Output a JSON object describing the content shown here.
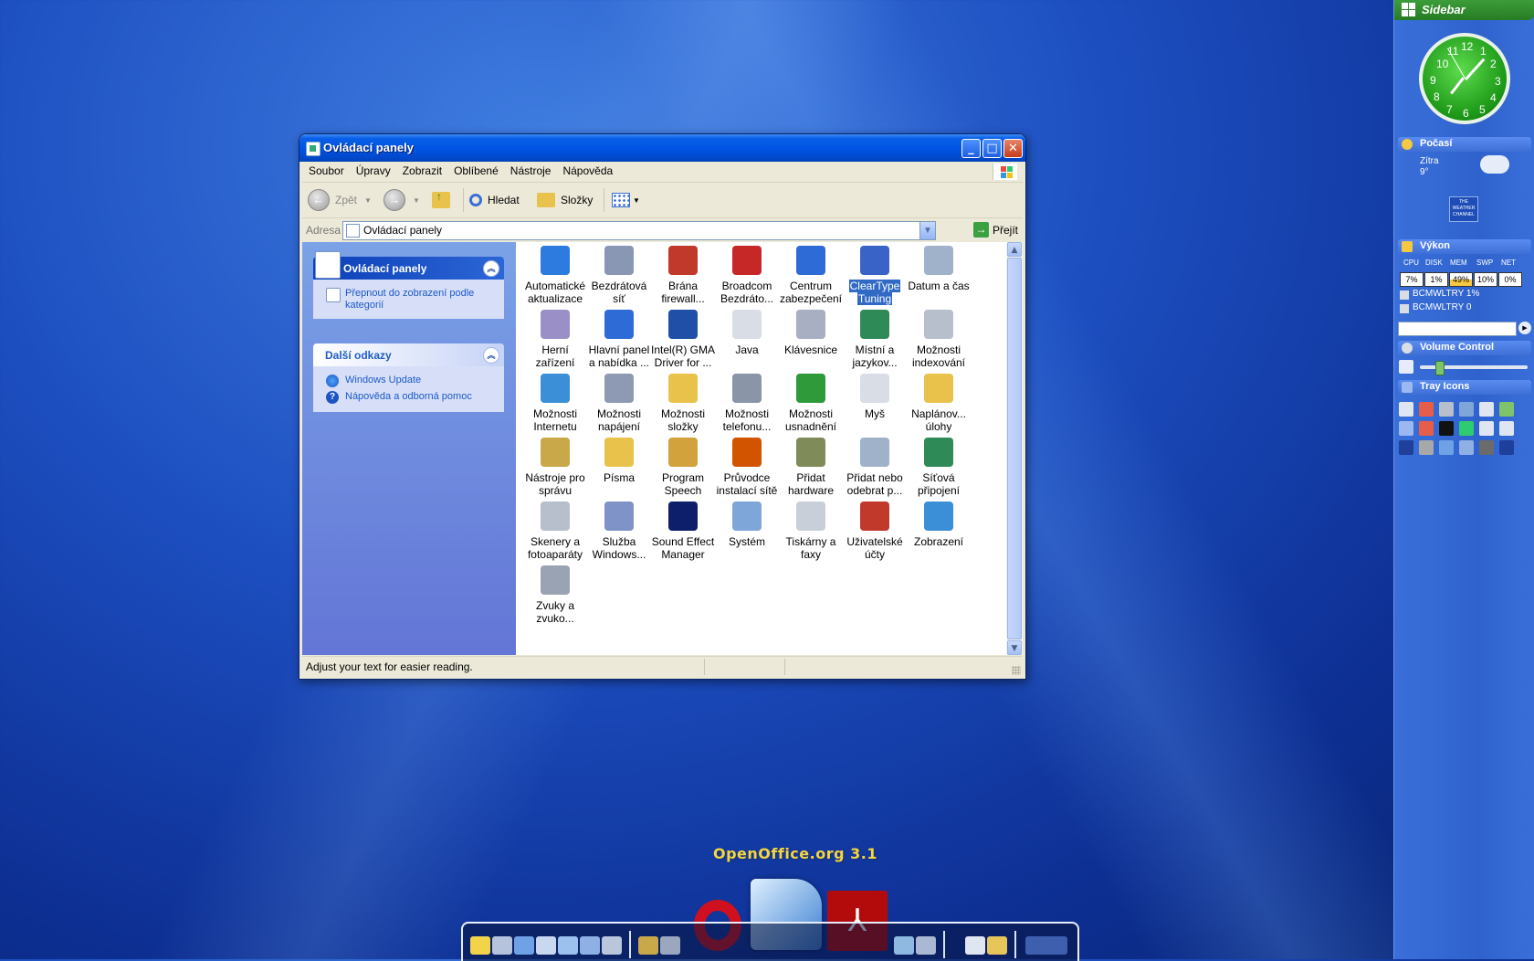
{
  "window": {
    "title": "Ovládací panely",
    "menu": [
      "Soubor",
      "Úpravy",
      "Zobrazit",
      "Oblíbené",
      "Nástroje",
      "Nápověda"
    ],
    "toolbar": {
      "back": "Zpět",
      "search": "Hledat",
      "folders": "Složky"
    },
    "address": {
      "label": "Adresa",
      "value": "Ovládací panely",
      "go": "Přejít"
    },
    "task_pane": {
      "panel_title": "Ovládací panely",
      "switch_view": "Přepnout do zobrazení podle kategorií",
      "links_title": "Další odkazy",
      "links": [
        "Windows Update",
        "Nápověda a odborná pomoc"
      ]
    },
    "items": [
      {
        "line1": "Automatické",
        "line2": "aktualizace",
        "icon": "windows-update-icon",
        "color": "#2e7be0"
      },
      {
        "line1": "Bezdrátová",
        "line2": "síť",
        "icon": "wireless-network-icon",
        "color": "#8a97b4"
      },
      {
        "line1": "Brána",
        "line2": "firewall...",
        "icon": "firewall-icon",
        "color": "#c0392b"
      },
      {
        "line1": "Broadcom",
        "line2": "Bezdráto...",
        "icon": "broadcom-wireless-icon",
        "color": "#c62828"
      },
      {
        "line1": "Centrum",
        "line2": "zabezpečení",
        "icon": "security-center-icon",
        "color": "#2f6bd6"
      },
      {
        "line1": "ClearType",
        "line2": "Tuning",
        "icon": "cleartype-icon",
        "color": "#3a63c8",
        "selected": true
      },
      {
        "line1": "Datum a čas",
        "line2": "",
        "icon": "date-time-icon",
        "color": "#9fb2c9"
      },
      {
        "line1": "Herní",
        "line2": "zařízení",
        "icon": "game-controller-icon",
        "color": "#9b8fc7"
      },
      {
        "line1": "Hlavní panel",
        "line2": "a nabídka ...",
        "icon": "taskbar-icon",
        "color": "#2f6bd6"
      },
      {
        "line1": "Intel(R) GMA",
        "line2": "Driver for ...",
        "icon": "intel-gma-icon",
        "color": "#1f4fa6"
      },
      {
        "line1": "Java",
        "line2": "",
        "icon": "java-icon",
        "color": "#d9dde6"
      },
      {
        "line1": "Klávesnice",
        "line2": "",
        "icon": "keyboard-icon",
        "color": "#a8afc2"
      },
      {
        "line1": "Místní a",
        "line2": "jazykov...",
        "icon": "regional-globe-icon",
        "color": "#2e8b57"
      },
      {
        "line1": "Možnosti",
        "line2": "indexování",
        "icon": "indexing-icon",
        "color": "#b7bfcc"
      },
      {
        "line1": "Možnosti",
        "line2": "Internetu",
        "icon": "internet-options-icon",
        "color": "#3b8fd6"
      },
      {
        "line1": "Možnosti",
        "line2": "napájení",
        "icon": "power-options-icon",
        "color": "#8e9ab3"
      },
      {
        "line1": "Možnosti",
        "line2": "složky",
        "icon": "folder-options-icon",
        "color": "#e8c24a"
      },
      {
        "line1": "Možnosti",
        "line2": "telefonu...",
        "icon": "phone-modem-icon",
        "color": "#8b95a8"
      },
      {
        "line1": "Možnosti",
        "line2": "usnadnění",
        "icon": "accessibility-icon",
        "color": "#2e9a3a"
      },
      {
        "line1": "Myš",
        "line2": "",
        "icon": "mouse-icon",
        "color": "#d9dde6"
      },
      {
        "line1": "Naplánov...",
        "line2": "úlohy",
        "icon": "scheduled-tasks-icon",
        "color": "#e8c24a"
      },
      {
        "line1": "Nástroje pro",
        "line2": "správu",
        "icon": "admin-tools-icon",
        "color": "#c9a84a"
      },
      {
        "line1": "Písma",
        "line2": "",
        "icon": "fonts-folder-icon",
        "color": "#e8c24a"
      },
      {
        "line1": "Program",
        "line2": "Speech",
        "icon": "speech-icon",
        "color": "#d2a23c"
      },
      {
        "line1": "Průvodce",
        "line2": "instalací sítě",
        "icon": "network-wizard-icon",
        "color": "#d35400"
      },
      {
        "line1": "Přidat",
        "line2": "hardware",
        "icon": "add-hardware-icon",
        "color": "#7f8c5a"
      },
      {
        "line1": "Přidat nebo",
        "line2": "odebrat p...",
        "icon": "add-remove-programs-icon",
        "color": "#9fb2c9"
      },
      {
        "line1": "Síťová",
        "line2": "připojení",
        "icon": "network-connections-icon",
        "color": "#2e8b57"
      },
      {
        "line1": "Skenery a",
        "line2": "fotoaparáty",
        "icon": "scanner-camera-icon",
        "color": "#b7bfcc"
      },
      {
        "line1": "Služba",
        "line2": "Windows...",
        "icon": "windows-service-icon",
        "color": "#7f93c9"
      },
      {
        "line1": "Sound Effect",
        "line2": "Manager",
        "icon": "sound-effect-icon",
        "color": "#0d1f6b"
      },
      {
        "line1": "Systém",
        "line2": "",
        "icon": "system-icon",
        "color": "#7fa6d9"
      },
      {
        "line1": "Tiskárny a",
        "line2": "faxy",
        "icon": "printers-faxes-icon",
        "color": "#c9cfd9"
      },
      {
        "line1": "Uživatelské",
        "line2": "účty",
        "icon": "user-accounts-icon",
        "color": "#c0392b"
      },
      {
        "line1": "Zobrazení",
        "line2": "",
        "icon": "display-icon",
        "color": "#3b8fd6"
      },
      {
        "line1": "Zvuky a",
        "line2": "zvuko...",
        "icon": "sounds-icon",
        "color": "#9aa3b3"
      }
    ],
    "status": "Adjust your text for easier reading."
  },
  "sidebar": {
    "title": "Sidebar",
    "clock_numbers": [
      "12",
      "1",
      "2",
      "3",
      "4",
      "5",
      "6",
      "7",
      "8",
      "9",
      "10",
      "11"
    ],
    "weather": {
      "title": "Počasí",
      "day": "Zítra",
      "temp": "9°",
      "provider_logo": "THE WEATHER CHANNEL"
    },
    "performance": {
      "title": "Výkon",
      "labels": [
        "CPU",
        "DISK",
        "MEM",
        "SWP",
        "NET"
      ],
      "values": [
        "7%",
        "1%",
        "49%",
        "10%",
        "0%"
      ],
      "mem_level_percent": 49,
      "lines": [
        "BCMWLTRY 1%",
        "BCMWLTRY 0"
      ]
    },
    "volume": {
      "title": "Volume Control",
      "level_percent": 15
    },
    "tray": {
      "title": "Tray Icons"
    }
  },
  "dock": {
    "label": "OpenOffice.org 3.1"
  }
}
